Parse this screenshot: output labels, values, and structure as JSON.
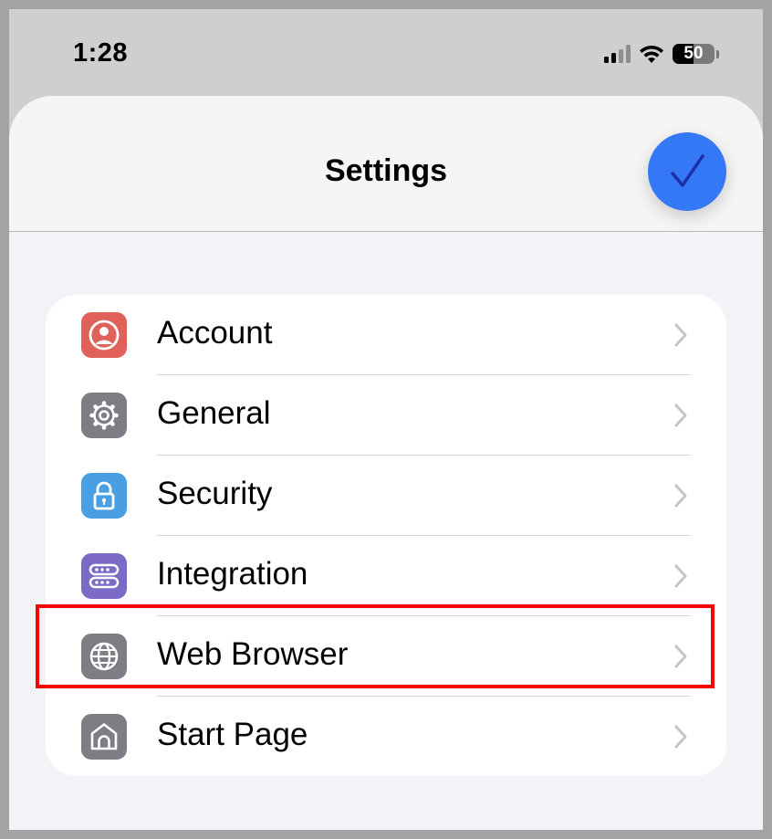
{
  "status_bar": {
    "time": "1:28",
    "battery_level": "50",
    "signal_bars_active": 2,
    "signal_bars_total": 4
  },
  "header": {
    "title": "Settings",
    "done_icon": "checkmark-icon",
    "accent_color": "#3478f6"
  },
  "settings_items": [
    {
      "label": "Account",
      "icon": "person-circle-icon",
      "color": "#e0605a"
    },
    {
      "label": "General",
      "icon": "gear-icon",
      "color": "#7d7e83"
    },
    {
      "label": "Security",
      "icon": "lock-icon",
      "color": "#4a9fe3"
    },
    {
      "label": "Integration",
      "icon": "server-icon",
      "color": "#7d6ac6"
    },
    {
      "label": "Web Browser",
      "icon": "globe-icon",
      "color": "#7d7e83",
      "highlighted": true
    },
    {
      "label": "Start Page",
      "icon": "house-icon",
      "color": "#7d7e83"
    }
  ],
  "highlight_color": "#ff0000"
}
